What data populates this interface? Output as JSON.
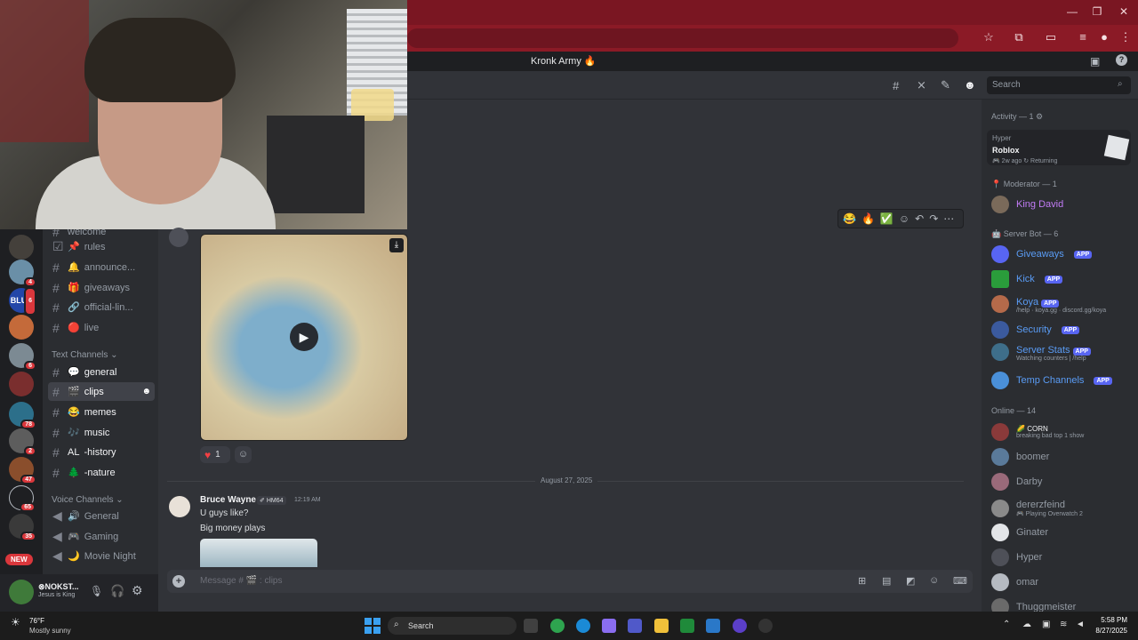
{
  "server": {
    "title": "Kronk Army 🔥"
  },
  "header": {
    "search_placeholder": "Search"
  },
  "channels": {
    "top_partial": "welcome",
    "items": [
      {
        "label": "rules",
        "prefix": "📌"
      },
      {
        "label": "announce...",
        "prefix": "🔔"
      },
      {
        "label": "giveaways",
        "prefix": "🎁"
      },
      {
        "label": "official-lin...",
        "prefix": "🔗"
      },
      {
        "label": "live",
        "prefix": "🔴"
      }
    ],
    "text_category": "Text Channels",
    "text": [
      {
        "label": "general",
        "prefix": "💬"
      },
      {
        "label": "clips",
        "prefix": "🎬"
      },
      {
        "label": "memes",
        "prefix": "😂"
      },
      {
        "label": "music",
        "prefix": "🎶"
      },
      {
        "label": "-history",
        "prefix": "AL"
      },
      {
        "label": "-nature",
        "prefix": "🌲"
      }
    ],
    "voice_category": "Voice Channels",
    "voice": [
      {
        "label": "General",
        "prefix": "🔊"
      },
      {
        "label": "Gaming",
        "prefix": "🎮"
      },
      {
        "label": "Movie Night",
        "prefix": "🌙"
      }
    ]
  },
  "rail_badges": [
    "4",
    "6",
    "6",
    "78",
    "2",
    "47",
    "65",
    "35"
  ],
  "rail_new": "NEW",
  "user": {
    "name": "⊗NOKST...",
    "status": "Jesus is King"
  },
  "message1": {
    "reaction_count": "1"
  },
  "divider_date": "August 27, 2025",
  "message2": {
    "author": "Bruce Wayne",
    "tag": "HM64",
    "time": "12:19 AM",
    "lines": [
      "U guys like?",
      "Big money plays"
    ]
  },
  "composer": {
    "placeholder": "Message # 🎬 : clips"
  },
  "members": {
    "activity_header": "Activity — 1",
    "activity": {
      "user": "Hyper",
      "game": "Roblox",
      "meta": "2w ago",
      "status": "Returning"
    },
    "moderator_header": "Moderator — 1",
    "moderators": [
      {
        "name": "King David"
      }
    ],
    "bot_header": "Server Bot — 6",
    "bots": [
      {
        "name": "Giveaways",
        "sub": ""
      },
      {
        "name": "Kick",
        "sub": ""
      },
      {
        "name": "Koya",
        "sub": "/help · koya.gg · discord.gg/koya"
      },
      {
        "name": "Security",
        "sub": ""
      },
      {
        "name": "Server Stats",
        "sub": "Watching counters | /help"
      },
      {
        "name": "Temp Channels",
        "sub": ""
      }
    ],
    "app_tag": "APP",
    "online_header": "Online — 14",
    "online": [
      {
        "name": "CORN",
        "sub": "breaking bad top 1 show"
      },
      {
        "name": "boomer",
        "sub": ""
      },
      {
        "name": "Darby",
        "sub": ""
      },
      {
        "name": "dererzfeind",
        "sub": "Playing Overwatch 2"
      },
      {
        "name": "Ginater",
        "sub": ""
      },
      {
        "name": "Hyper",
        "sub": ""
      },
      {
        "name": "omar",
        "sub": ""
      },
      {
        "name": "Thuggmeister",
        "sub": ""
      }
    ]
  },
  "taskbar": {
    "weather_temp": "76°F",
    "weather_desc": "Mostly sunny",
    "search": "Search",
    "time": "5:58 PM",
    "date": "8/27/2025"
  },
  "colors": {
    "accent": "#5865f2",
    "moderator": "#c27cf6",
    "bot": "#5a9cf5",
    "browser": "#8b1a26"
  }
}
